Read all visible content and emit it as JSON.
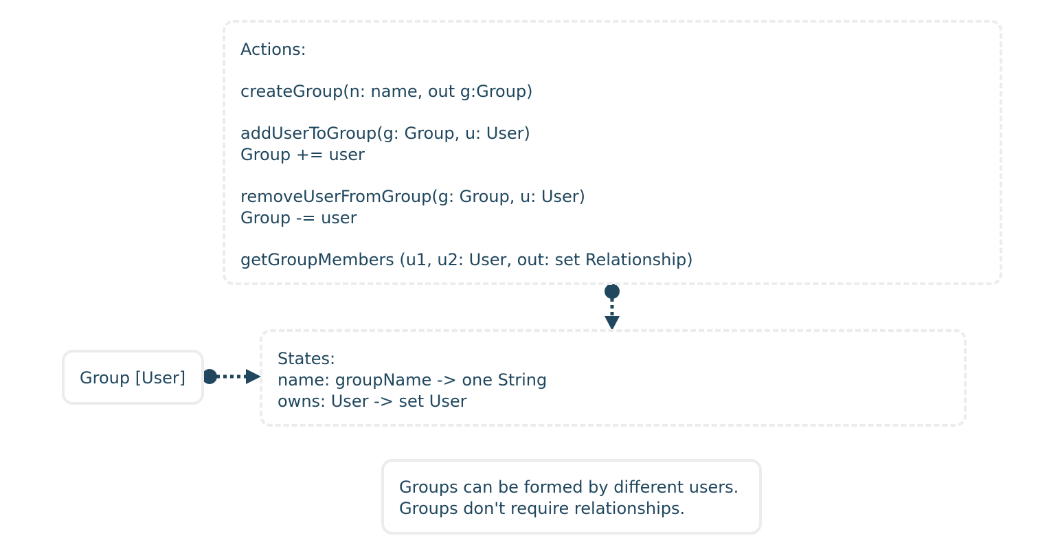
{
  "actions": {
    "lines": [
      "Actions:",
      "",
      "createGroup(n: name, out g:Group)",
      "",
      "addUserToGroup(g: Group, u: User)",
      "Group += user",
      "",
      "removeUserFromGroup(g: Group, u: User)",
      "Group -= user",
      "",
      "getGroupMembers (u1, u2: User, out: set Relationship)"
    ]
  },
  "states": {
    "lines": [
      "States:",
      "name: groupName -> one String",
      "owns: User -> set User"
    ]
  },
  "group": {
    "label": "Group [User]"
  },
  "note": {
    "lines": [
      "Groups can be formed by different users.",
      "Groups don't require relationships."
    ]
  },
  "colors": {
    "text": "#20475e",
    "connector": "#20475e",
    "border": "#ececec",
    "background": "#ffffff"
  }
}
